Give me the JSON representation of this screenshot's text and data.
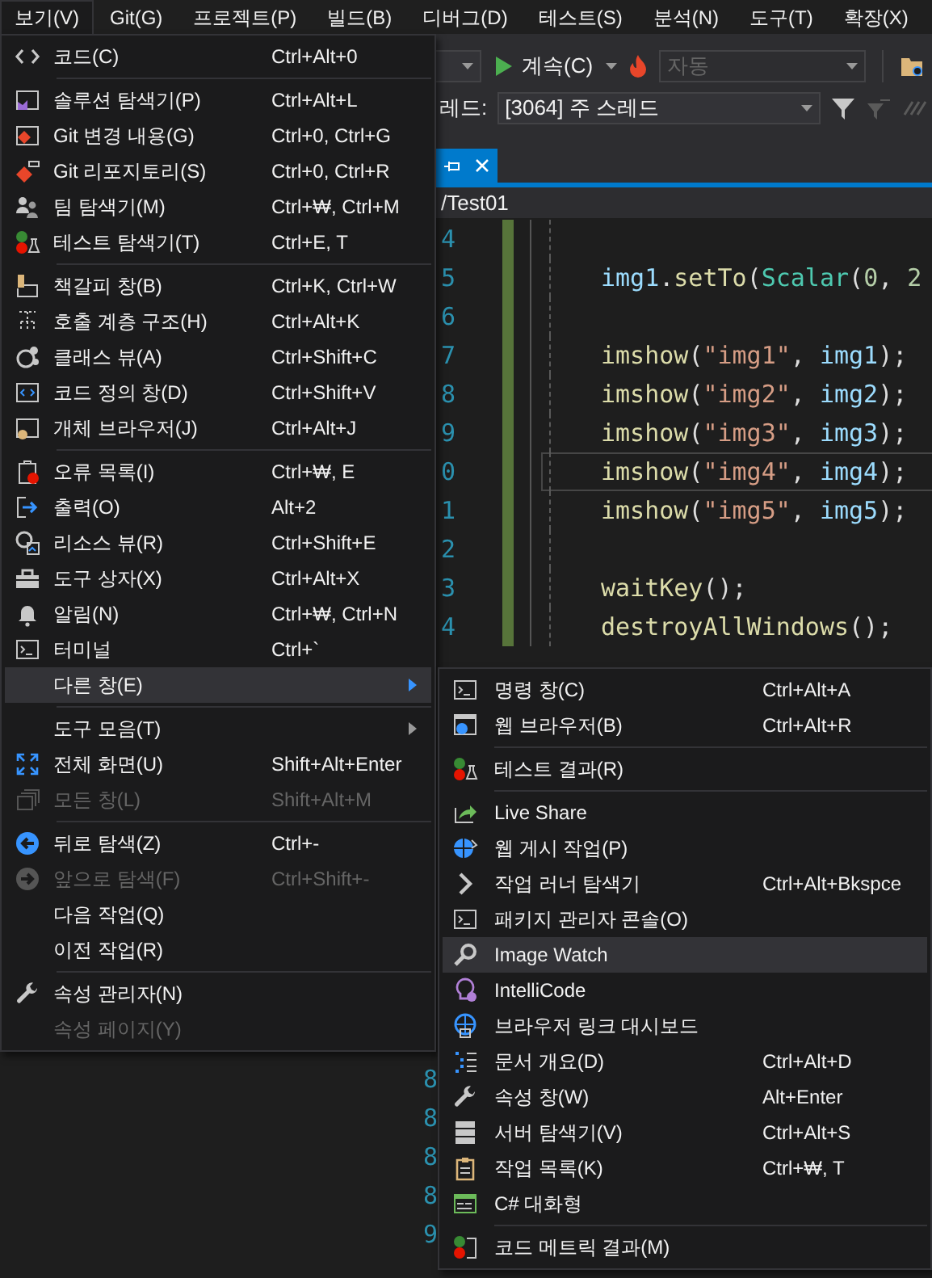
{
  "menubar": [
    {
      "label": "보기(V)",
      "selected": true
    },
    {
      "label": "Git(G)",
      "selected": false
    },
    {
      "label": "프로젝트(P)",
      "selected": false
    },
    {
      "label": "빌드(B)",
      "selected": false
    },
    {
      "label": "디버그(D)",
      "selected": false
    },
    {
      "label": "테스트(S)",
      "selected": false
    },
    {
      "label": "분석(N)",
      "selected": false
    },
    {
      "label": "도구(T)",
      "selected": false
    },
    {
      "label": "확장(X)",
      "selected": false
    }
  ],
  "toolbar": {
    "continue_button": "계속(C)",
    "config_dropdown": {
      "value": "자동",
      "disabled": true
    }
  },
  "thread_bar": {
    "label": "레드:",
    "thread_dropdown": "[3064] 주 스레드"
  },
  "document_tab": {
    "selected": true
  },
  "path": "/Test01",
  "editor": {
    "top_lines": [
      {
        "num": "4",
        "changed": true,
        "current": false
      },
      {
        "num": "5",
        "changed": true,
        "current": false,
        "tokens": [
          {
            "text": "img1",
            "kind": "var"
          },
          {
            "text": ".",
            "kind": "plain"
          },
          {
            "text": "setTo",
            "kind": "func"
          },
          {
            "text": "(",
            "kind": "plain"
          },
          {
            "text": "Scalar",
            "kind": "type"
          },
          {
            "text": "(",
            "kind": "plain"
          },
          {
            "text": "0",
            "kind": "num"
          },
          {
            "text": ", ",
            "kind": "plain"
          },
          {
            "text": "2",
            "kind": "num"
          }
        ]
      },
      {
        "num": "6",
        "changed": true,
        "current": false
      },
      {
        "num": "7",
        "changed": true,
        "current": false,
        "tokens": [
          {
            "text": "imshow",
            "kind": "func"
          },
          {
            "text": "(",
            "kind": "plain"
          },
          {
            "text": "\"img1\"",
            "kind": "str"
          },
          {
            "text": ", ",
            "kind": "plain"
          },
          {
            "text": "img1",
            "kind": "var"
          },
          {
            "text": ");",
            "kind": "plain"
          }
        ]
      },
      {
        "num": "8",
        "changed": true,
        "current": false,
        "tokens": [
          {
            "text": "imshow",
            "kind": "func"
          },
          {
            "text": "(",
            "kind": "plain"
          },
          {
            "text": "\"img2\"",
            "kind": "str"
          },
          {
            "text": ", ",
            "kind": "plain"
          },
          {
            "text": "img2",
            "kind": "var"
          },
          {
            "text": ");",
            "kind": "plain"
          }
        ]
      },
      {
        "num": "9",
        "changed": true,
        "current": false,
        "tokens": [
          {
            "text": "imshow",
            "kind": "func"
          },
          {
            "text": "(",
            "kind": "plain"
          },
          {
            "text": "\"img3\"",
            "kind": "str"
          },
          {
            "text": ", ",
            "kind": "plain"
          },
          {
            "text": "img3",
            "kind": "var"
          },
          {
            "text": ");",
            "kind": "plain"
          }
        ]
      },
      {
        "num": "0",
        "changed": true,
        "current": true,
        "tokens": [
          {
            "text": "imshow",
            "kind": "func"
          },
          {
            "text": "(",
            "kind": "plain"
          },
          {
            "text": "\"img4\"",
            "kind": "str"
          },
          {
            "text": ", ",
            "kind": "plain"
          },
          {
            "text": "img4",
            "kind": "var"
          },
          {
            "text": ");",
            "kind": "plain"
          }
        ]
      },
      {
        "num": "1",
        "changed": true,
        "current": false,
        "tokens": [
          {
            "text": "imshow",
            "kind": "func"
          },
          {
            "text": "(",
            "kind": "plain"
          },
          {
            "text": "\"img5\"",
            "kind": "str"
          },
          {
            "text": ", ",
            "kind": "plain"
          },
          {
            "text": "img5",
            "kind": "var"
          },
          {
            "text": ");",
            "kind": "plain"
          }
        ]
      },
      {
        "num": "2",
        "changed": true,
        "current": false
      },
      {
        "num": "3",
        "changed": true,
        "current": false,
        "tokens": [
          {
            "text": "waitKey",
            "kind": "func"
          },
          {
            "text": "();",
            "kind": "plain"
          }
        ]
      },
      {
        "num": "4",
        "changed": true,
        "current": false,
        "tokens": [
          {
            "text": "destroyAllWindows",
            "kind": "func"
          },
          {
            "text": "();",
            "kind": "plain"
          }
        ]
      }
    ],
    "bottom_lines": [
      {
        "num": "8"
      },
      {
        "num": "8"
      },
      {
        "num": "8"
      },
      {
        "num": "8"
      },
      {
        "num": "9"
      }
    ]
  },
  "view_menu": {
    "items": [
      {
        "kind": "item",
        "label": "코드(C)",
        "shortcut": "Ctrl+Alt+0",
        "highlighted": false,
        "disabled": false,
        "submenu": false
      },
      {
        "kind": "separator"
      },
      {
        "kind": "item",
        "label": "솔루션 탐색기(P)",
        "shortcut": "Ctrl+Alt+L",
        "highlighted": false,
        "disabled": false,
        "submenu": false
      },
      {
        "kind": "item",
        "label": "Git 변경 내용(G)",
        "shortcut": "Ctrl+0, Ctrl+G",
        "highlighted": false,
        "disabled": false,
        "submenu": false
      },
      {
        "kind": "item",
        "label": "Git 리포지토리(S)",
        "shortcut": "Ctrl+0, Ctrl+R",
        "highlighted": false,
        "disabled": false,
        "submenu": false
      },
      {
        "kind": "item",
        "label": "팀 탐색기(M)",
        "shortcut": "Ctrl+₩, Ctrl+M",
        "highlighted": false,
        "disabled": false,
        "submenu": false
      },
      {
        "kind": "item",
        "label": "테스트 탐색기(T)",
        "shortcut": "Ctrl+E, T",
        "highlighted": false,
        "disabled": false,
        "submenu": false
      },
      {
        "kind": "separator"
      },
      {
        "kind": "item",
        "label": "책갈피 창(B)",
        "shortcut": "Ctrl+K, Ctrl+W",
        "highlighted": false,
        "disabled": false,
        "submenu": false
      },
      {
        "kind": "item",
        "label": "호출 계층 구조(H)",
        "shortcut": "Ctrl+Alt+K",
        "highlighted": false,
        "disabled": false,
        "submenu": false
      },
      {
        "kind": "item",
        "label": "클래스 뷰(A)",
        "shortcut": "Ctrl+Shift+C",
        "highlighted": false,
        "disabled": false,
        "submenu": false
      },
      {
        "kind": "item",
        "label": "코드 정의 창(D)",
        "shortcut": "Ctrl+Shift+V",
        "highlighted": false,
        "disabled": false,
        "submenu": false
      },
      {
        "kind": "item",
        "label": "개체 브라우저(J)",
        "shortcut": "Ctrl+Alt+J",
        "highlighted": false,
        "disabled": false,
        "submenu": false
      },
      {
        "kind": "separator"
      },
      {
        "kind": "item",
        "label": "오류 목록(I)",
        "shortcut": "Ctrl+₩, E",
        "highlighted": false,
        "disabled": false,
        "submenu": false
      },
      {
        "kind": "item",
        "label": "출력(O)",
        "shortcut": "Alt+2",
        "highlighted": false,
        "disabled": false,
        "submenu": false
      },
      {
        "kind": "item",
        "label": "리소스 뷰(R)",
        "shortcut": "Ctrl+Shift+E",
        "highlighted": false,
        "disabled": false,
        "submenu": false
      },
      {
        "kind": "item",
        "label": "도구 상자(X)",
        "shortcut": "Ctrl+Alt+X",
        "highlighted": false,
        "disabled": false,
        "submenu": false
      },
      {
        "kind": "item",
        "label": "알림(N)",
        "shortcut": "Ctrl+₩, Ctrl+N",
        "highlighted": false,
        "disabled": false,
        "submenu": false
      },
      {
        "kind": "item",
        "label": "터미널",
        "shortcut": "Ctrl+`",
        "highlighted": false,
        "disabled": false,
        "submenu": false
      },
      {
        "kind": "item",
        "label": "다른 창(E)",
        "highlighted": true,
        "disabled": false,
        "submenu": true
      },
      {
        "kind": "separator"
      },
      {
        "kind": "item",
        "label": "도구 모음(T)",
        "highlighted": false,
        "disabled": false,
        "submenu": true
      },
      {
        "kind": "item",
        "label": "전체 화면(U)",
        "shortcut": "Shift+Alt+Enter",
        "highlighted": false,
        "disabled": false,
        "submenu": false
      },
      {
        "kind": "item",
        "label": "모든 창(L)",
        "shortcut": "Shift+Alt+M",
        "highlighted": false,
        "disabled": true,
        "submenu": false
      },
      {
        "kind": "separator"
      },
      {
        "kind": "item",
        "label": "뒤로 탐색(Z)",
        "shortcut": "Ctrl+-",
        "highlighted": false,
        "disabled": false,
        "submenu": false
      },
      {
        "kind": "item",
        "label": "앞으로 탐색(F)",
        "shortcut": "Ctrl+Shift+-",
        "highlighted": false,
        "disabled": true,
        "submenu": false
      },
      {
        "kind": "item",
        "label": "다음 작업(Q)",
        "highlighted": false,
        "disabled": false,
        "submenu": false
      },
      {
        "kind": "item",
        "label": "이전 작업(R)",
        "highlighted": false,
        "disabled": false,
        "submenu": false
      },
      {
        "kind": "separator"
      },
      {
        "kind": "item",
        "label": "속성 관리자(N)",
        "highlighted": false,
        "disabled": false,
        "submenu": false
      },
      {
        "kind": "item",
        "label": "속성 페이지(Y)",
        "highlighted": false,
        "disabled": true,
        "submenu": false
      }
    ]
  },
  "other_windows_menu": {
    "items": [
      {
        "kind": "item",
        "label": "명령 창(C)",
        "shortcut": "Ctrl+Alt+A",
        "highlighted": false,
        "disabled": false,
        "submenu": false
      },
      {
        "kind": "item",
        "label": "웹 브라우저(B)",
        "shortcut": "Ctrl+Alt+R",
        "highlighted": false,
        "disabled": false,
        "submenu": false
      },
      {
        "kind": "separator"
      },
      {
        "kind": "item",
        "label": "테스트 결과(R)",
        "highlighted": false,
        "disabled": false,
        "submenu": false
      },
      {
        "kind": "separator"
      },
      {
        "kind": "item",
        "label": "Live Share",
        "highlighted": false,
        "disabled": false,
        "submenu": false
      },
      {
        "kind": "item",
        "label": "웹 게시 작업(P)",
        "highlighted": false,
        "disabled": false,
        "submenu": false
      },
      {
        "kind": "item",
        "label": "작업 러너 탐색기",
        "shortcut": "Ctrl+Alt+Bkspce",
        "highlighted": false,
        "disabled": false,
        "submenu": false
      },
      {
        "kind": "item",
        "label": "패키지 관리자 콘솔(O)",
        "highlighted": false,
        "disabled": false,
        "submenu": false
      },
      {
        "kind": "item",
        "label": "Image Watch",
        "highlighted": true,
        "disabled": false,
        "submenu": false
      },
      {
        "kind": "item",
        "label": "IntelliCode",
        "highlighted": false,
        "disabled": false,
        "submenu": false
      },
      {
        "kind": "item",
        "label": "브라우저 링크 대시보드",
        "highlighted": false,
        "disabled": false,
        "submenu": false
      },
      {
        "kind": "item",
        "label": "문서 개요(D)",
        "shortcut": "Ctrl+Alt+D",
        "highlighted": false,
        "disabled": false,
        "submenu": false
      },
      {
        "kind": "item",
        "label": "속성 창(W)",
        "shortcut": "Alt+Enter",
        "highlighted": false,
        "disabled": false,
        "submenu": false
      },
      {
        "kind": "item",
        "label": "서버 탐색기(V)",
        "shortcut": "Ctrl+Alt+S",
        "highlighted": false,
        "disabled": false,
        "submenu": false
      },
      {
        "kind": "item",
        "label": "작업 목록(K)",
        "shortcut": "Ctrl+₩, T",
        "highlighted": false,
        "disabled": false,
        "submenu": false
      },
      {
        "kind": "item",
        "label": "C# 대화형",
        "highlighted": false,
        "disabled": false,
        "submenu": false
      },
      {
        "kind": "separator"
      },
      {
        "kind": "item",
        "label": "코드 메트릭 결과(M)",
        "highlighted": false,
        "disabled": false,
        "submenu": false
      }
    ]
  }
}
